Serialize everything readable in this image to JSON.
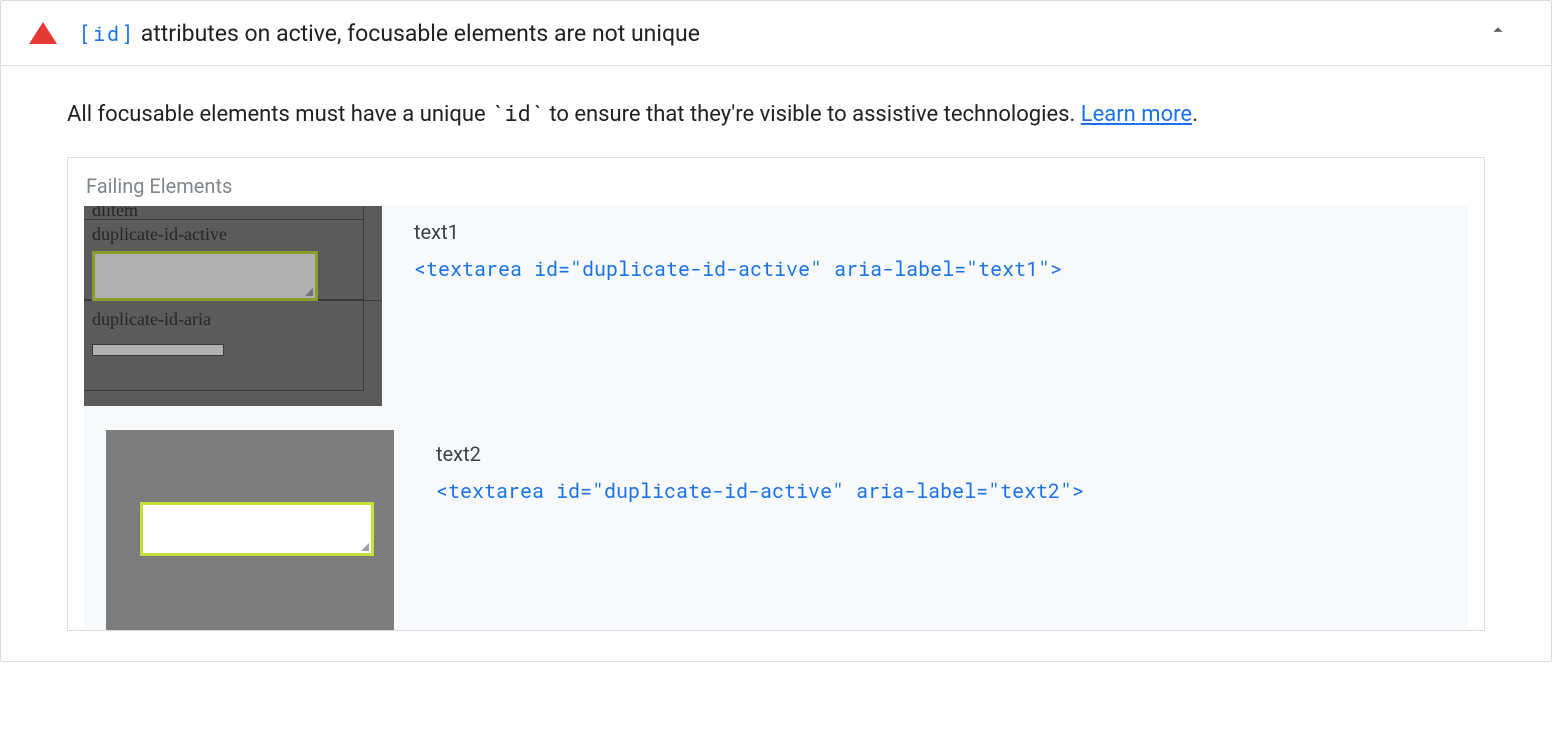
{
  "audit": {
    "code_label": "[id]",
    "title_rest": " attributes on active, focusable elements are not unique",
    "description_prefix": "All focusable elements must have a unique ",
    "description_code": "`id`",
    "description_suffix": " to ensure that they're visible to assistive technologies. ",
    "learn_more": "Learn more",
    "learn_period": "."
  },
  "failing": {
    "section_title": "Failing Elements",
    "items": [
      {
        "label": "text1",
        "snippet": "<textarea id=\"duplicate-id-active\" aria-label=\"text1\">"
      },
      {
        "label": "text2",
        "snippet": "<textarea id=\"duplicate-id-active\" aria-label=\"text2\">"
      }
    ],
    "thumb1": {
      "line_top": "dlitem",
      "label1": "duplicate-id-active",
      "label2": "duplicate-id-aria"
    }
  }
}
